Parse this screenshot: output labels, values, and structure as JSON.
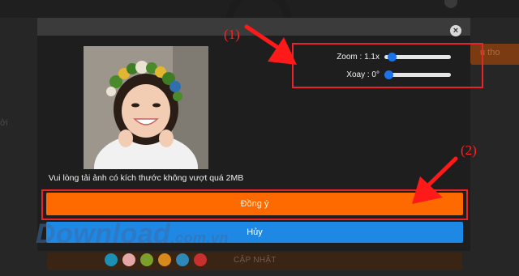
{
  "background": {
    "right_button_text": "u tho",
    "left_text": "ởi",
    "bottom_button_label": "CẬP NHẬT",
    "color_swatches": [
      "#1b8fb4",
      "#e5a6a6",
      "#7aa02a",
      "#d68a1c",
      "#2e88b8",
      "#c83030"
    ]
  },
  "modal": {
    "close_symbol": "×",
    "caption": "Vui lòng tải ảnh có kích thước không vượt quá 2MB",
    "zoom": {
      "label": "Zoom : 1.1x",
      "value": 0.06
    },
    "rotate": {
      "label": "Xoay : 0°",
      "value": 0.0
    },
    "agree_label": "Đồng ý",
    "cancel_label": "Hủy"
  },
  "annotations": {
    "label_1": "(1)",
    "label_2": "(2)"
  },
  "watermark": {
    "text": "Download",
    "suffix": ".com.vn"
  },
  "colors": {
    "agree": "#ff6a00",
    "cancel": "#1e88e5",
    "highlight": "#e8242a",
    "slider_thumb": "#1a73e8"
  }
}
